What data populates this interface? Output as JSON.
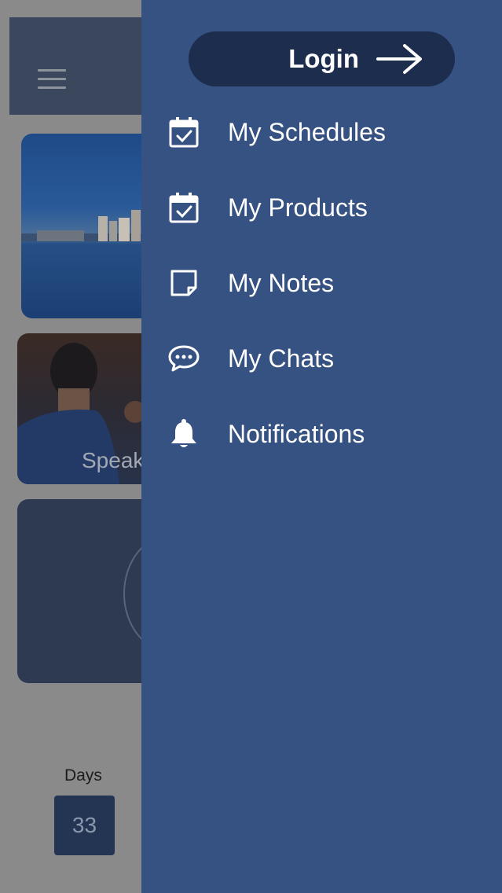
{
  "drawer": {
    "login_label": "Login",
    "items": [
      {
        "label": "My Schedules",
        "icon": "calendar-check-icon"
      },
      {
        "label": "My Products",
        "icon": "calendar-check-icon"
      },
      {
        "label": "My Notes",
        "icon": "note-icon"
      },
      {
        "label": "My Chats",
        "icon": "chat-bubble-icon"
      },
      {
        "label": "Notifications",
        "icon": "bell-icon"
      }
    ]
  },
  "background": {
    "speaker_label": "Speak",
    "days_label": "Days",
    "days_value": "33"
  },
  "colors": {
    "drawer_bg": "#365282",
    "login_bg": "#1d2d4d",
    "text": "#ffffff"
  }
}
